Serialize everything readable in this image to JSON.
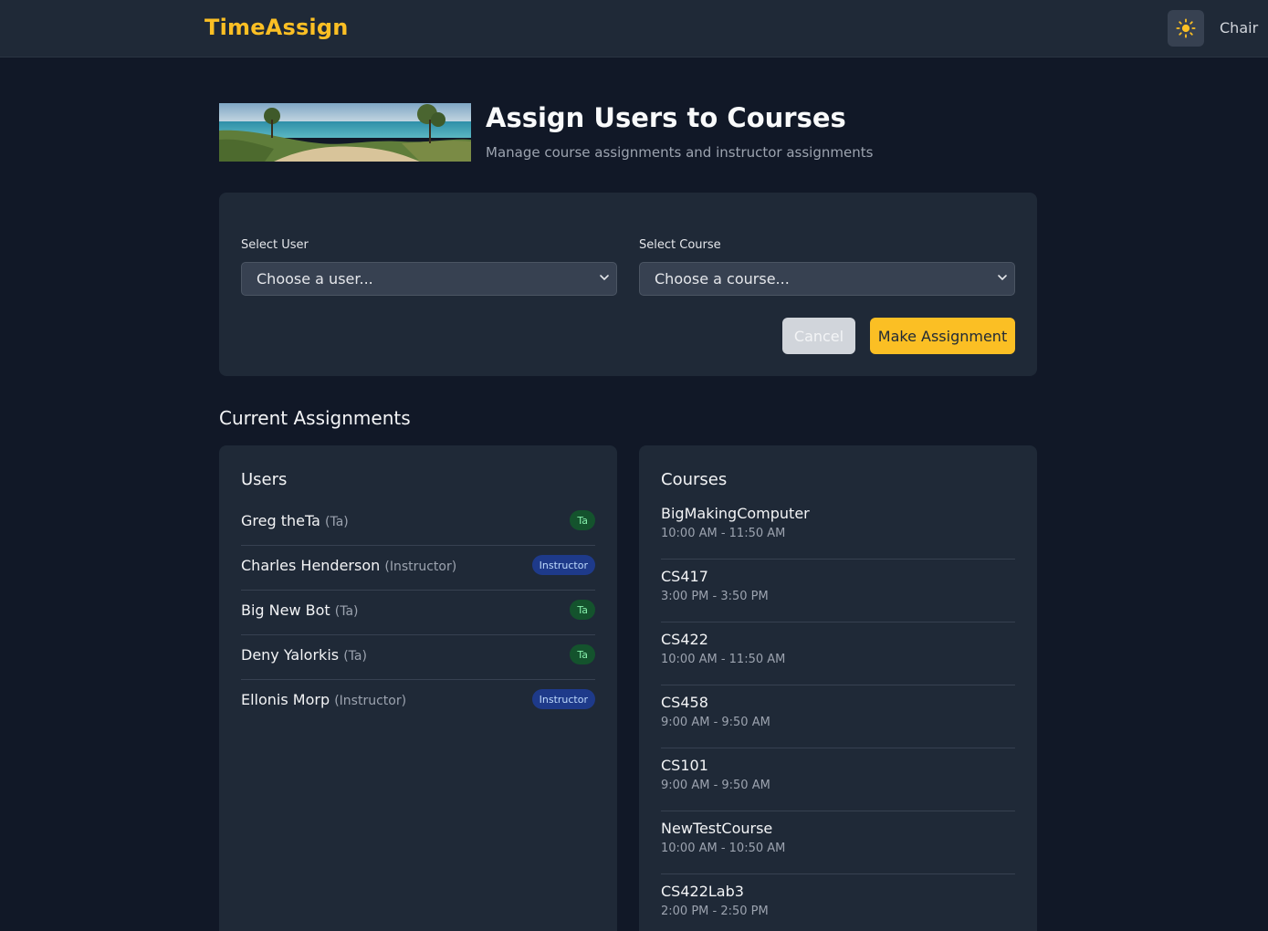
{
  "header": {
    "brand": "TimeAssign",
    "theme_icon": "sun-icon",
    "user_name": "Chair"
  },
  "page": {
    "title": "Assign Users to Courses",
    "subtitle": "Manage course assignments and instructor assignments"
  },
  "form": {
    "user_label": "Select User",
    "user_value": "Choose a user...",
    "course_label": "Select Course",
    "course_value": "Choose a course...",
    "cancel_label": "Cancel",
    "submit_label": "Make Assignment"
  },
  "assignments": {
    "heading": "Current Assignments",
    "users_title": "Users",
    "users": [
      {
        "name": "Greg theTa",
        "role": "(Ta)",
        "badge": "Ta"
      },
      {
        "name": "Charles Henderson",
        "role": "(Instructor)",
        "badge": "Instructor"
      },
      {
        "name": "Big New Bot",
        "role": "(Ta)",
        "badge": "Ta"
      },
      {
        "name": "Deny Yalorkis",
        "role": "(Ta)",
        "badge": "Ta"
      },
      {
        "name": "Ellonis Morp",
        "role": "(Instructor)",
        "badge": "Instructor"
      }
    ],
    "courses_title": "Courses",
    "courses": [
      {
        "name": "BigMakingComputer",
        "time": "10:00 AM - 11:50 AM"
      },
      {
        "name": "CS417",
        "time": "3:00 PM - 3:50 PM"
      },
      {
        "name": "CS422",
        "time": "10:00 AM - 11:50 AM"
      },
      {
        "name": "CS458",
        "time": "9:00 AM - 9:50 AM"
      },
      {
        "name": "CS101",
        "time": "9:00 AM - 9:50 AM"
      },
      {
        "name": "NewTestCourse",
        "time": "10:00 AM - 10:50 AM"
      },
      {
        "name": "CS422Lab3",
        "time": "2:00 PM - 2:50 PM"
      }
    ]
  },
  "colors": {
    "accent": "#fbbf24",
    "background": "#111827",
    "card": "#1f2937",
    "ta_badge": "#14532d",
    "instructor_badge": "#1e3a8a"
  }
}
